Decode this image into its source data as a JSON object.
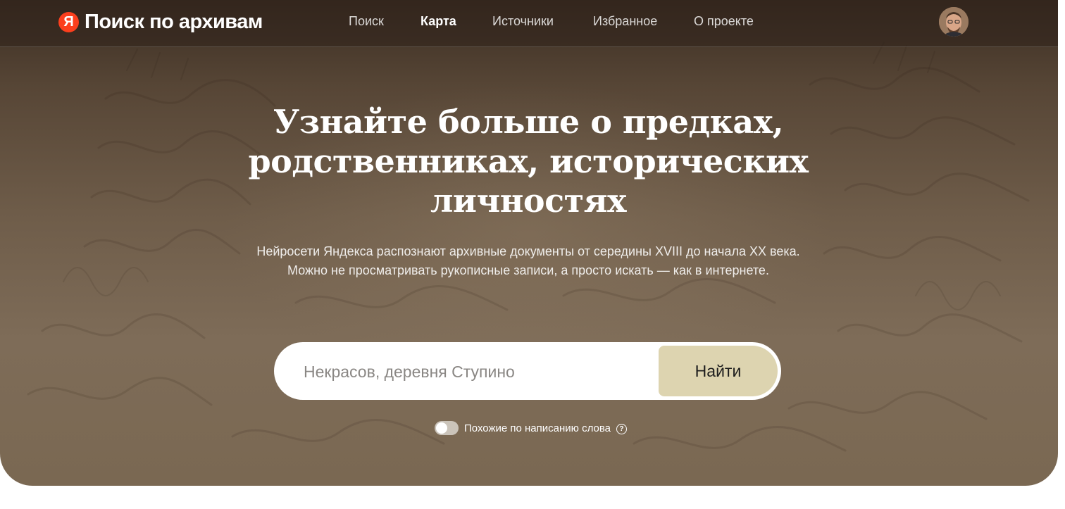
{
  "header": {
    "logo_mark": "Я",
    "logo_text": "Поиск по архивам",
    "nav": [
      {
        "label": "Поиск",
        "active": false
      },
      {
        "label": "Карта",
        "active": true
      },
      {
        "label": "Источники",
        "active": false
      },
      {
        "label": "Избранное",
        "active": false
      },
      {
        "label": "О проекте",
        "active": false
      }
    ],
    "avatar_icon": "user-avatar"
  },
  "hero": {
    "headline_lines": [
      "Узнайте больше о предках,",
      "родственниках, исторических",
      "личностях"
    ],
    "subtitle_lines": [
      "Нейросети Яндекса распознают архивные документы от середины XVIII до начала XX века.",
      "Можно не просматривать рукописные записи, а просто искать — как в интернете."
    ]
  },
  "search": {
    "placeholder": "Некрасов, деревня Ступино",
    "value": "",
    "button_label": "Найти"
  },
  "options": {
    "similar_spelling_label": "Похожие по написанию слова",
    "similar_spelling_enabled": false,
    "help_icon": "question-circle-icon"
  },
  "colors": {
    "brand_red": "#fc3f1d",
    "search_button": "#ddd4b0",
    "hero_dark": "#3b2d22",
    "hero_light": "#7e6c58"
  }
}
